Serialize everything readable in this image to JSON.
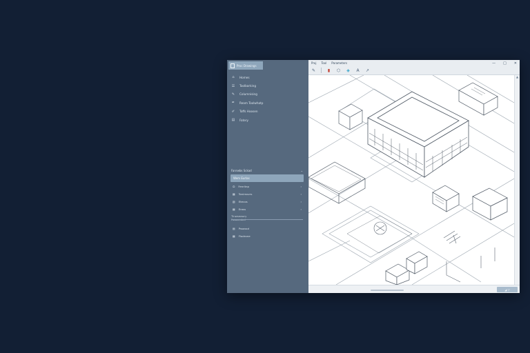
{
  "app": {
    "title": "Proc Drawings"
  },
  "menu": [
    "Proj",
    "Tool",
    "Parameters"
  ],
  "toolbar": [
    {
      "icon": "pencil-icon",
      "glyph": "✎"
    },
    {
      "icon": "paint-icon",
      "glyph": "▮"
    },
    {
      "icon": "tag-icon",
      "glyph": "⬡"
    },
    {
      "icon": "droplet-icon",
      "glyph": "◈"
    },
    {
      "icon": "text-icon",
      "glyph": "A"
    },
    {
      "icon": "cursor-icon",
      "glyph": "↗"
    }
  ],
  "window_controls": {
    "minimize": "—",
    "maximize": "□",
    "close": "✕"
  },
  "sidebar": {
    "items": [
      {
        "icon": "home-icon",
        "glyph": "⌂",
        "label": "Homes"
      },
      {
        "icon": "layers-icon",
        "glyph": "☰",
        "label": "Toolbarking"
      },
      {
        "icon": "draw-icon",
        "glyph": "✎",
        "label": "Columnising"
      },
      {
        "icon": "pen-icon",
        "glyph": "✒",
        "label": "Ream Toolwhatp"
      },
      {
        "icon": "edit-icon",
        "glyph": "✐",
        "label": "Toffs Hoosen"
      },
      {
        "icon": "file-icon",
        "glyph": "▤",
        "label": "Fatery"
      }
    ],
    "section": {
      "title": "Fanrwbs Sckad",
      "chevron": "⌄"
    },
    "selected": "Wem Eurlas",
    "sub_items": [
      {
        "icon": "shape-icon",
        "glyph": "⬭",
        "label": "Fenrlinp",
        "arrow": "›"
      },
      {
        "icon": "grid-icon",
        "glyph": "▦",
        "label": "Tonimovrs",
        "arrow": "›"
      },
      {
        "icon": "block-icon",
        "glyph": "▧",
        "label": "Etecos",
        "arrow": "›"
      },
      {
        "icon": "table-icon",
        "glyph": "▦",
        "label": "Eross",
        "arrow": "›"
      }
    ],
    "sub_label": "Tinwseowry",
    "sub_label2": "Fowaunded",
    "bottom_items": [
      {
        "icon": "doc-icon",
        "glyph": "▤",
        "label": "Pssossd"
      },
      {
        "icon": "list-icon",
        "glyph": "▦",
        "label": "Flodrone"
      }
    ]
  },
  "status": {
    "zoom_label": "◢ ▽"
  },
  "colors": {
    "background": "#121f34",
    "sidebar": "#56697e",
    "sidebar_highlight": "#8ea6bb",
    "canvas": "#ffffff"
  }
}
